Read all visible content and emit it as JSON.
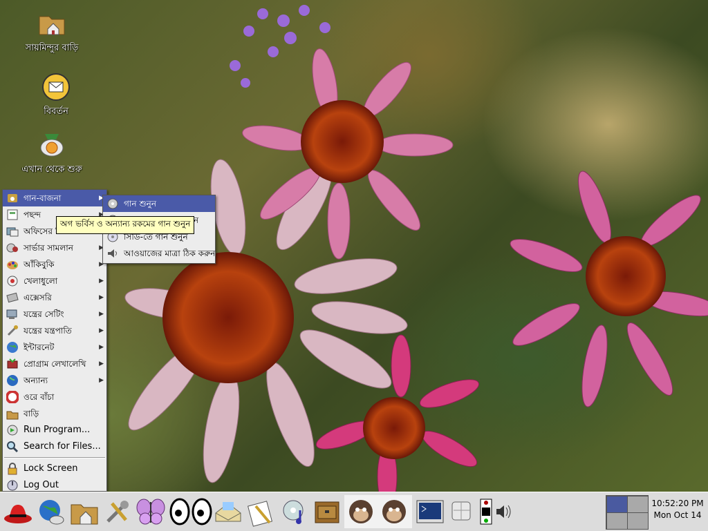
{
  "desktop": {
    "icons": [
      {
        "label": "সায়মিন্দুর বাড়ি",
        "icon": "home-folder-icon"
      },
      {
        "label": "বিবর্তন",
        "icon": "evolution-mail-icon"
      },
      {
        "label": "এখান থেকে শুরু",
        "icon": "start-here-icon"
      }
    ]
  },
  "main_menu": {
    "items": [
      {
        "label": "গান-বাজনা",
        "icon": "music-icon",
        "submenu": true
      },
      {
        "label": "পছন্দ",
        "icon": "preferences-icon",
        "submenu": true
      },
      {
        "label": "অফিসের জিনিসপত্র",
        "icon": "office-icon",
        "submenu": true
      },
      {
        "label": "সার্ভার সামলান",
        "icon": "server-icon",
        "submenu": true
      },
      {
        "label": "আঁকিবুকি",
        "icon": "graphics-icon",
        "submenu": true
      },
      {
        "label": "খেলাধুলো",
        "icon": "games-icon",
        "submenu": true
      },
      {
        "label": "এক্সেসরি",
        "icon": "accessories-icon",
        "submenu": true
      },
      {
        "label": "যন্ত্রের সেটিং",
        "icon": "system-settings-icon",
        "submenu": true
      },
      {
        "label": "যন্ত্রের যন্ত্রপাতি",
        "icon": "system-tools-icon",
        "submenu": true
      },
      {
        "label": "ইন্টারনেট",
        "icon": "internet-icon",
        "submenu": true
      },
      {
        "label": "প্রোগ্রাম লেখালেখি",
        "icon": "programming-icon",
        "submenu": true
      },
      {
        "label": "অন্যান্য",
        "icon": "other-icon",
        "submenu": true
      },
      {
        "label": "ওরে বাঁচা",
        "icon": "help-icon",
        "submenu": false
      },
      {
        "label": "বাড়ি",
        "icon": "home-icon",
        "submenu": false
      }
    ],
    "run_program": "Run Program...",
    "search_files": "Search for Files...",
    "lock_screen": "Lock Screen",
    "log_out": "Log Out"
  },
  "sound_submenu": {
    "items": [
      {
        "label": "গান শুনুন",
        "icon": "audio-player-icon"
      },
      {
        "label": "ন",
        "icon": "audio-player-icon"
      },
      {
        "label": "সিডি-তে গান শুনুন",
        "icon": "cd-player-icon"
      },
      {
        "label": "আওয়াজের মাত্রা ঠিক করুন",
        "icon": "volume-control-icon"
      }
    ]
  },
  "tooltip": "অগ ভর্বিস ও অন্যান্য রকমের গান শুনুন",
  "panel": {
    "launchers": [
      "redhat-menu-icon",
      "web-browser-icon",
      "home-folder-icon",
      "tools-icon",
      "butterfly-icon",
      "eyes-icon",
      "mail-icon",
      "text-editor-icon",
      "sound-juicer-icon",
      "drawer-icon",
      "monkey-icon",
      "terminal-icon",
      "network-monitor-icon",
      "battery-icon",
      "volume-icon"
    ],
    "clock_time": "10:52:20 PM",
    "clock_date": "Mon Oct 14"
  },
  "colors": {
    "menu_highlight": "#4a5aa8",
    "menu_bg": "#ececec",
    "tooltip_bg": "#ffffc0",
    "panel_bg": "#dcdcdc"
  }
}
